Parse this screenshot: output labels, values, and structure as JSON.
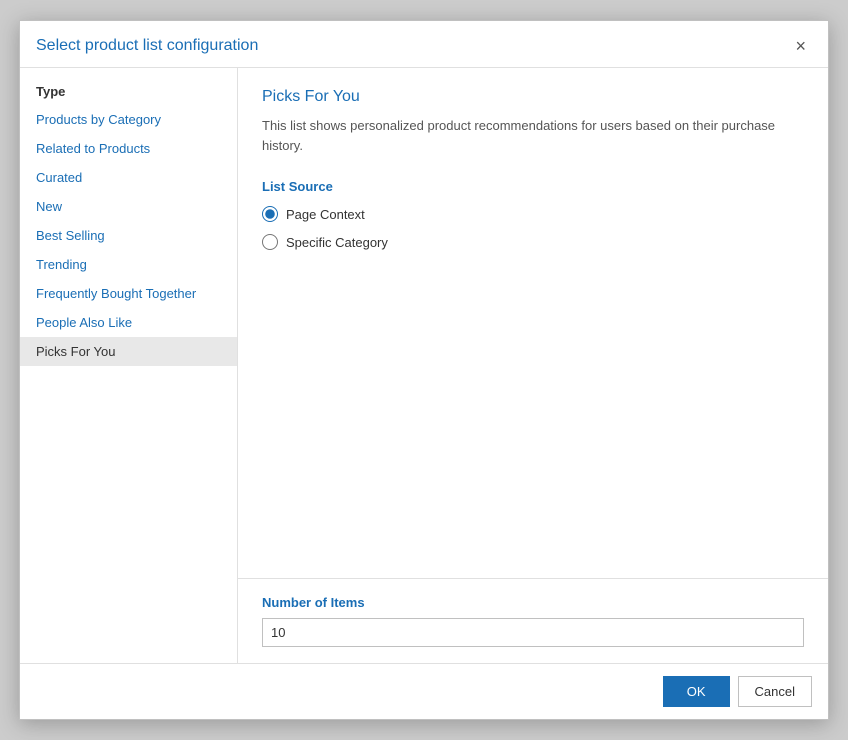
{
  "dialog": {
    "title": "Select product list configuration",
    "close_label": "×"
  },
  "sidebar": {
    "header": "Type",
    "items": [
      {
        "label": "Products by Category",
        "active": false
      },
      {
        "label": "Related to Products",
        "active": false
      },
      {
        "label": "Curated",
        "active": false
      },
      {
        "label": "New",
        "active": false
      },
      {
        "label": "Best Selling",
        "active": false
      },
      {
        "label": "Trending",
        "active": false
      },
      {
        "label": "Frequently Bought Together",
        "active": false
      },
      {
        "label": "People Also Like",
        "active": false
      },
      {
        "label": "Picks For You",
        "active": true
      }
    ]
  },
  "content": {
    "title": "Picks For You",
    "description": "This list shows personalized product recommendations for users based on their purchase history.",
    "list_source_label": "List Source",
    "radio_options": [
      {
        "label": "Page Context",
        "checked": true
      },
      {
        "label": "Specific Category",
        "checked": false
      }
    ],
    "number_of_items_label": "Number of Items",
    "number_of_items_value": "10",
    "number_of_items_placeholder": ""
  },
  "actions": {
    "ok_label": "OK",
    "cancel_label": "Cancel"
  }
}
